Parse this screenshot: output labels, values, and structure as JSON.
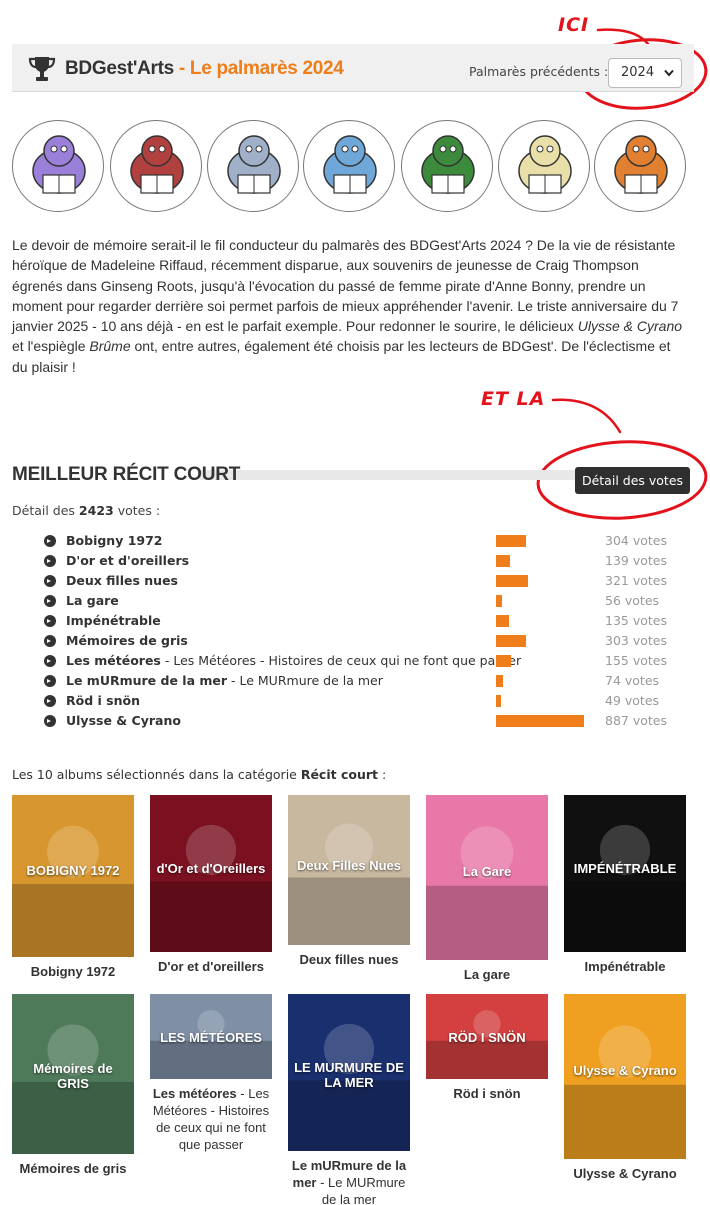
{
  "annotations": {
    "ici": "ICI",
    "et_la": "ET LA",
    "color": "#e3121b"
  },
  "header": {
    "brand": "BDGest'Arts",
    "separator": " - ",
    "palmares": "Le palmarès 2024",
    "previous_label": "Palmarès précédents :",
    "selected_year": "2024"
  },
  "mascots": [
    {
      "icon": "walrus-reader-icon",
      "color": "#9a80d8"
    },
    {
      "icon": "creature-with-book-icon",
      "color": "#b0413e"
    },
    {
      "icon": "elephant-reading-icon",
      "color": "#9fb0c8"
    },
    {
      "icon": "frog-reading-icon",
      "color": "#6fa8d8"
    },
    {
      "icon": "dragon-reading-icon",
      "color": "#3c8a3c"
    },
    {
      "icon": "owls-reading-icon",
      "color": "#e8e0a8"
    },
    {
      "icon": "monkey-with-tablet-icon",
      "color": "#e08030"
    }
  ],
  "intro": {
    "part1": "Le devoir de mémoire serait-il le fil conducteur du palmarès des BDGest'Arts 2024 ? De la vie de résistante héroïque de Madeleine Riffaud, récemment disparue, aux souvenirs de jeunesse de Craig Thompson égrenés dans Ginseng Roots, jusqu'à l'évocation du passé de femme pirate d'Anne Bonny, prendre un moment pour regarder derrière soi permet parfois de mieux appréhender l'avenir. Le triste anniversaire du 7 janvier 2025 - 10 ans déjà - en est le parfait exemple. Pour redonner le sourire, le délicieux ",
    "em1": "Ulysse & Cyrano",
    "part2": " et l'espiègle ",
    "em2": "Brûme",
    "part3": " ont, entre autres, également été choisis par les lecteurs de BDGest'. De l'éclectisme et du plaisir !"
  },
  "section": {
    "title": "MEILLEUR RÉCIT COURT",
    "detail_button": "Détail des votes",
    "votes_prefix": "Détail des ",
    "votes_total": "2423",
    "votes_suffix": " votes :"
  },
  "votes": [
    {
      "title": "Bobigny 1972",
      "subtitle": "",
      "votes": 304,
      "label": "304 votes"
    },
    {
      "title": "D'or et d'oreillers",
      "subtitle": "",
      "votes": 139,
      "label": "139 votes"
    },
    {
      "title": "Deux filles nues",
      "subtitle": "",
      "votes": 321,
      "label": "321 votes"
    },
    {
      "title": "La gare",
      "subtitle": "",
      "votes": 56,
      "label": "56 votes"
    },
    {
      "title": "Impénétrable",
      "subtitle": "",
      "votes": 135,
      "label": "135 votes"
    },
    {
      "title": "Mémoires de gris",
      "subtitle": "",
      "votes": 303,
      "label": "303 votes"
    },
    {
      "title": "Les météores",
      "subtitle": " - Les Météores - Histoires de ceux qui ne font que passer",
      "votes": 155,
      "label": "155 votes"
    },
    {
      "title": "Le mURmure de la mer",
      "subtitle": " - Le MURmure de la mer",
      "votes": 74,
      "label": "74 votes"
    },
    {
      "title": "Röd i snön",
      "subtitle": "",
      "votes": 49,
      "label": "49 votes"
    },
    {
      "title": "Ulysse & Cyrano",
      "subtitle": "",
      "votes": 887,
      "label": "887 votes"
    }
  ],
  "vote_max": 887,
  "bar_color": "#ef7d1a",
  "albums_intro": {
    "prefix": "Les 10 albums sélectionnés dans la catégorie ",
    "category": "Récit court",
    "suffix": " :"
  },
  "albums": [
    {
      "title": "Bobigny 1972",
      "subtitle": "",
      "cover_text": "BOBIGNY 1972",
      "cover_color": "#d8962f"
    },
    {
      "title": "D'or et d'oreillers",
      "subtitle": "",
      "cover_text": "d'Or et d'Oreillers",
      "cover_color": "#7a1020"
    },
    {
      "title": "Deux filles nues",
      "subtitle": "",
      "cover_text": "Deux Filles Nues",
      "cover_color": "#c8b8a0"
    },
    {
      "title": "La gare",
      "subtitle": "",
      "cover_text": "La Gare",
      "cover_color": "#e878a8"
    },
    {
      "title": "Impénétrable",
      "subtitle": "",
      "cover_text": "IMPÉNÉTRABLE",
      "cover_color": "#101010"
    },
    {
      "title": "Mémoires de gris",
      "subtitle": "",
      "cover_text": "Mémoires de GRIS",
      "cover_color": "#4f7a5a"
    },
    {
      "title": "Les météores",
      "subtitle": " - Les Météores - Histoires de ceux qui ne font que passer",
      "cover_text": "LES MÉTÉORES",
      "cover_color": "#7e8fa6"
    },
    {
      "title": "Le mURmure de la mer",
      "subtitle": " - Le MURmure de la mer",
      "cover_text": "LE MURMURE DE LA MER",
      "cover_color": "#1a2f6e"
    },
    {
      "title": "Röd i snön",
      "subtitle": "",
      "cover_text": "RÖD I SNÖN",
      "cover_color": "#d44040"
    },
    {
      "title": "Ulysse & Cyrano",
      "subtitle": "",
      "cover_text": "Ulysse & Cyrano",
      "cover_color": "#f0a020"
    }
  ]
}
